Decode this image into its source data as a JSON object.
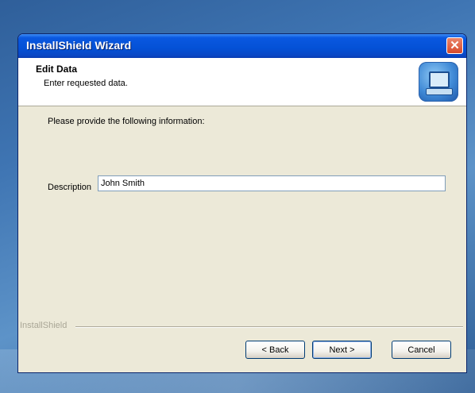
{
  "window": {
    "title": "InstallShield Wizard",
    "close_icon": "close-icon"
  },
  "header": {
    "title": "Edit Data",
    "subtitle": "Enter requested data.",
    "icon": "installer-computer-icon"
  },
  "body": {
    "prompt": "Please provide the following information:",
    "description_label": "Description",
    "description_value": "John Smith"
  },
  "footer": {
    "brand": "InstallShield",
    "back_label": "< Back",
    "next_label": "Next >",
    "cancel_label": "Cancel"
  }
}
